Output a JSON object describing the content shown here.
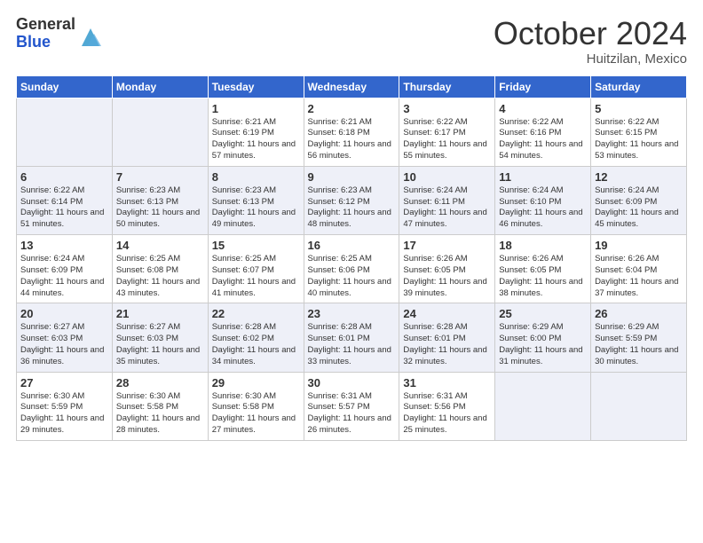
{
  "header": {
    "logo_general": "General",
    "logo_blue": "Blue",
    "month": "October 2024",
    "location": "Huitzilan, Mexico"
  },
  "days_of_week": [
    "Sunday",
    "Monday",
    "Tuesday",
    "Wednesday",
    "Thursday",
    "Friday",
    "Saturday"
  ],
  "weeks": [
    [
      {
        "day": "",
        "sunrise": "",
        "sunset": "",
        "daylight": ""
      },
      {
        "day": "",
        "sunrise": "",
        "sunset": "",
        "daylight": ""
      },
      {
        "day": "1",
        "sunrise": "Sunrise: 6:21 AM",
        "sunset": "Sunset: 6:19 PM",
        "daylight": "Daylight: 11 hours and 57 minutes."
      },
      {
        "day": "2",
        "sunrise": "Sunrise: 6:21 AM",
        "sunset": "Sunset: 6:18 PM",
        "daylight": "Daylight: 11 hours and 56 minutes."
      },
      {
        "day": "3",
        "sunrise": "Sunrise: 6:22 AM",
        "sunset": "Sunset: 6:17 PM",
        "daylight": "Daylight: 11 hours and 55 minutes."
      },
      {
        "day": "4",
        "sunrise": "Sunrise: 6:22 AM",
        "sunset": "Sunset: 6:16 PM",
        "daylight": "Daylight: 11 hours and 54 minutes."
      },
      {
        "day": "5",
        "sunrise": "Sunrise: 6:22 AM",
        "sunset": "Sunset: 6:15 PM",
        "daylight": "Daylight: 11 hours and 53 minutes."
      }
    ],
    [
      {
        "day": "6",
        "sunrise": "Sunrise: 6:22 AM",
        "sunset": "Sunset: 6:14 PM",
        "daylight": "Daylight: 11 hours and 51 minutes."
      },
      {
        "day": "7",
        "sunrise": "Sunrise: 6:23 AM",
        "sunset": "Sunset: 6:13 PM",
        "daylight": "Daylight: 11 hours and 50 minutes."
      },
      {
        "day": "8",
        "sunrise": "Sunrise: 6:23 AM",
        "sunset": "Sunset: 6:13 PM",
        "daylight": "Daylight: 11 hours and 49 minutes."
      },
      {
        "day": "9",
        "sunrise": "Sunrise: 6:23 AM",
        "sunset": "Sunset: 6:12 PM",
        "daylight": "Daylight: 11 hours and 48 minutes."
      },
      {
        "day": "10",
        "sunrise": "Sunrise: 6:24 AM",
        "sunset": "Sunset: 6:11 PM",
        "daylight": "Daylight: 11 hours and 47 minutes."
      },
      {
        "day": "11",
        "sunrise": "Sunrise: 6:24 AM",
        "sunset": "Sunset: 6:10 PM",
        "daylight": "Daylight: 11 hours and 46 minutes."
      },
      {
        "day": "12",
        "sunrise": "Sunrise: 6:24 AM",
        "sunset": "Sunset: 6:09 PM",
        "daylight": "Daylight: 11 hours and 45 minutes."
      }
    ],
    [
      {
        "day": "13",
        "sunrise": "Sunrise: 6:24 AM",
        "sunset": "Sunset: 6:09 PM",
        "daylight": "Daylight: 11 hours and 44 minutes."
      },
      {
        "day": "14",
        "sunrise": "Sunrise: 6:25 AM",
        "sunset": "Sunset: 6:08 PM",
        "daylight": "Daylight: 11 hours and 43 minutes."
      },
      {
        "day": "15",
        "sunrise": "Sunrise: 6:25 AM",
        "sunset": "Sunset: 6:07 PM",
        "daylight": "Daylight: 11 hours and 41 minutes."
      },
      {
        "day": "16",
        "sunrise": "Sunrise: 6:25 AM",
        "sunset": "Sunset: 6:06 PM",
        "daylight": "Daylight: 11 hours and 40 minutes."
      },
      {
        "day": "17",
        "sunrise": "Sunrise: 6:26 AM",
        "sunset": "Sunset: 6:05 PM",
        "daylight": "Daylight: 11 hours and 39 minutes."
      },
      {
        "day": "18",
        "sunrise": "Sunrise: 6:26 AM",
        "sunset": "Sunset: 6:05 PM",
        "daylight": "Daylight: 11 hours and 38 minutes."
      },
      {
        "day": "19",
        "sunrise": "Sunrise: 6:26 AM",
        "sunset": "Sunset: 6:04 PM",
        "daylight": "Daylight: 11 hours and 37 minutes."
      }
    ],
    [
      {
        "day": "20",
        "sunrise": "Sunrise: 6:27 AM",
        "sunset": "Sunset: 6:03 PM",
        "daylight": "Daylight: 11 hours and 36 minutes."
      },
      {
        "day": "21",
        "sunrise": "Sunrise: 6:27 AM",
        "sunset": "Sunset: 6:03 PM",
        "daylight": "Daylight: 11 hours and 35 minutes."
      },
      {
        "day": "22",
        "sunrise": "Sunrise: 6:28 AM",
        "sunset": "Sunset: 6:02 PM",
        "daylight": "Daylight: 11 hours and 34 minutes."
      },
      {
        "day": "23",
        "sunrise": "Sunrise: 6:28 AM",
        "sunset": "Sunset: 6:01 PM",
        "daylight": "Daylight: 11 hours and 33 minutes."
      },
      {
        "day": "24",
        "sunrise": "Sunrise: 6:28 AM",
        "sunset": "Sunset: 6:01 PM",
        "daylight": "Daylight: 11 hours and 32 minutes."
      },
      {
        "day": "25",
        "sunrise": "Sunrise: 6:29 AM",
        "sunset": "Sunset: 6:00 PM",
        "daylight": "Daylight: 11 hours and 31 minutes."
      },
      {
        "day": "26",
        "sunrise": "Sunrise: 6:29 AM",
        "sunset": "Sunset: 5:59 PM",
        "daylight": "Daylight: 11 hours and 30 minutes."
      }
    ],
    [
      {
        "day": "27",
        "sunrise": "Sunrise: 6:30 AM",
        "sunset": "Sunset: 5:59 PM",
        "daylight": "Daylight: 11 hours and 29 minutes."
      },
      {
        "day": "28",
        "sunrise": "Sunrise: 6:30 AM",
        "sunset": "Sunset: 5:58 PM",
        "daylight": "Daylight: 11 hours and 28 minutes."
      },
      {
        "day": "29",
        "sunrise": "Sunrise: 6:30 AM",
        "sunset": "Sunset: 5:58 PM",
        "daylight": "Daylight: 11 hours and 27 minutes."
      },
      {
        "day": "30",
        "sunrise": "Sunrise: 6:31 AM",
        "sunset": "Sunset: 5:57 PM",
        "daylight": "Daylight: 11 hours and 26 minutes."
      },
      {
        "day": "31",
        "sunrise": "Sunrise: 6:31 AM",
        "sunset": "Sunset: 5:56 PM",
        "daylight": "Daylight: 11 hours and 25 minutes."
      },
      {
        "day": "",
        "sunrise": "",
        "sunset": "",
        "daylight": ""
      },
      {
        "day": "",
        "sunrise": "",
        "sunset": "",
        "daylight": ""
      }
    ]
  ]
}
